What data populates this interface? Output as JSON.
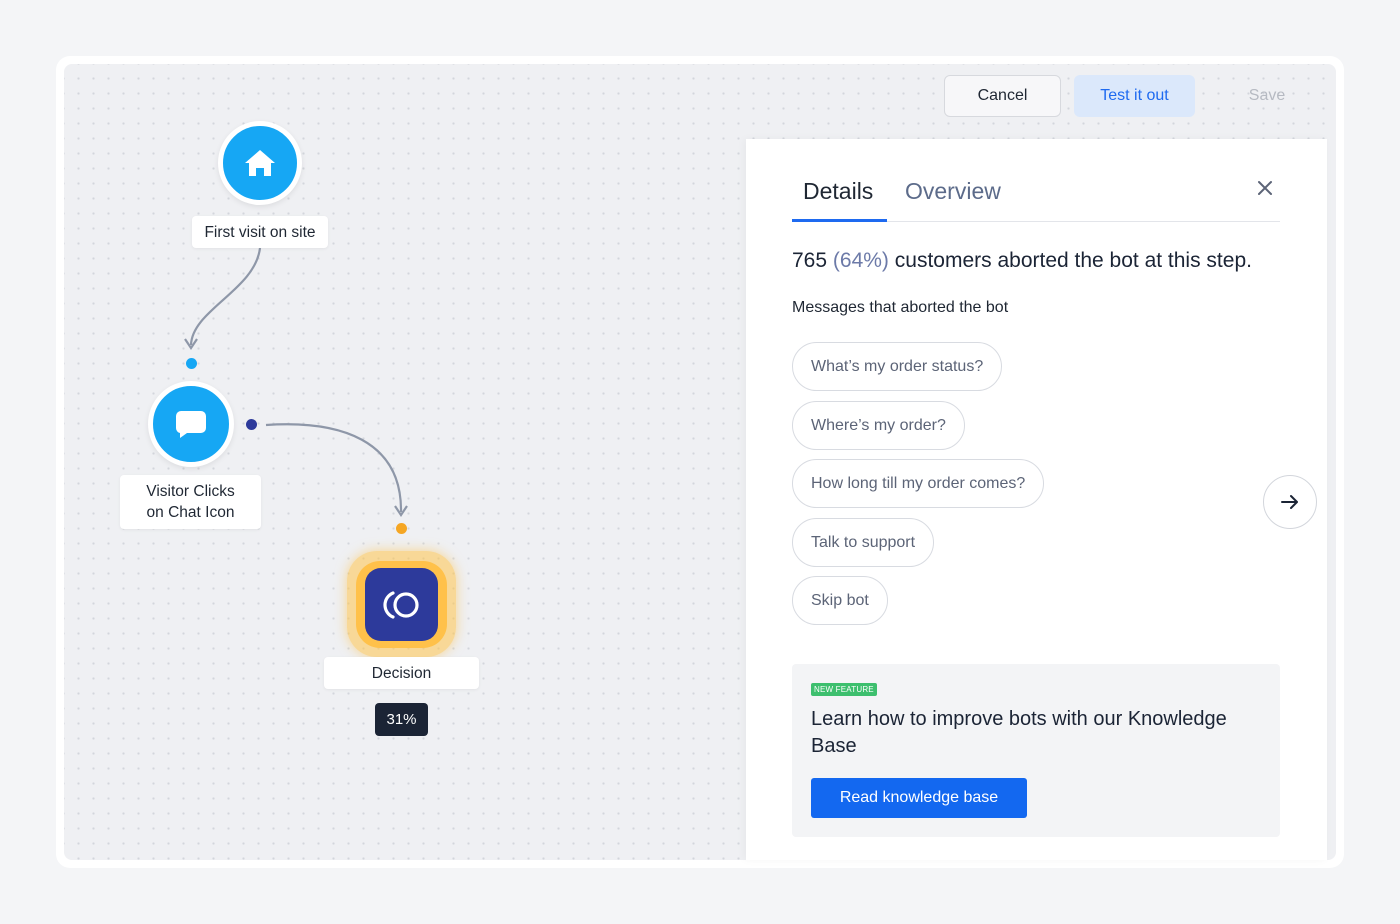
{
  "toolbar": {
    "cancel_label": "Cancel",
    "test_label": "Test it out",
    "save_label": "Save"
  },
  "flow": {
    "nodes": [
      {
        "label": "First visit on site",
        "icon": "home-icon"
      },
      {
        "label_line1": "Visitor Clicks",
        "label_line2": "on Chat Icon",
        "icon": "chat-bubble-icon"
      },
      {
        "label": "Decision",
        "icon": "decision-icon",
        "percent": "31%"
      }
    ]
  },
  "panel": {
    "tabs": [
      {
        "label": "Details",
        "active": true
      },
      {
        "label": "Overview",
        "active": false
      }
    ],
    "stat": {
      "count": "765",
      "percent": "(64%)",
      "text": "customers aborted the bot at this step."
    },
    "messages_heading": "Messages that aborted the bot",
    "messages": [
      "What’s my order status?",
      "Where’s my order?",
      "How long till my order comes?",
      "Talk to support",
      "Skip bot"
    ],
    "knowledge_card": {
      "badge": "NEW FEATURE",
      "title": "Learn how to improve bots with our Knowledge Base",
      "button_label": "Read knowledge base"
    }
  },
  "colors": {
    "node_blue": "#16a7f4",
    "decision_navy": "#2d3a9b",
    "decision_glow": "#ffc14a",
    "primary_blue": "#1368f0",
    "badge_green": "#3dbf6e"
  }
}
